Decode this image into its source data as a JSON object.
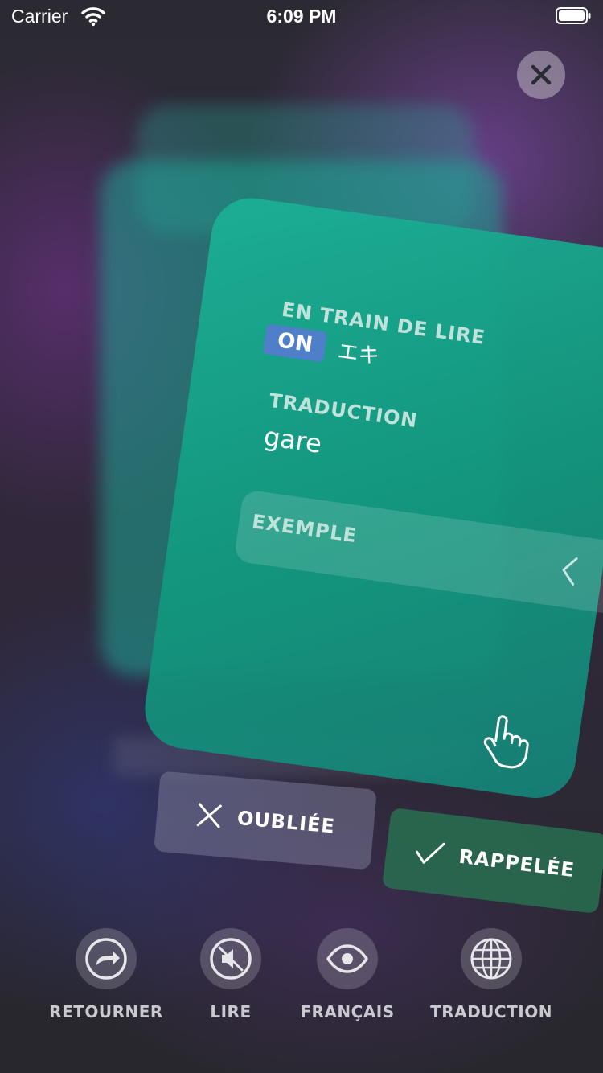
{
  "status_bar": {
    "carrier": "Carrier",
    "time": "6:09 PM"
  },
  "card": {
    "reading_label": "EN TRAIN DE LIRE",
    "reading_badge": "ON",
    "reading_kana": "エキ",
    "translation_label": "TRADUCTION",
    "translation_value": "gare",
    "example_label": "EXEMPLE"
  },
  "actions": {
    "forgot_label": "OUBLIÉE",
    "remembered_label": "RAPPELÉE"
  },
  "toolbar": {
    "items": [
      {
        "label": "RETOURNER",
        "icon": "flip-arrow-icon"
      },
      {
        "label": "LIRE",
        "icon": "speaker-muted-icon"
      },
      {
        "label": "FRANÇAIS",
        "icon": "eye-icon"
      },
      {
        "label": "TRADUCTION",
        "icon": "globe-icon"
      }
    ]
  },
  "colors": {
    "card": "#1caf96",
    "on_badge": "#4f7fc9",
    "remembered": "#286e50",
    "forgot": "#787896"
  }
}
